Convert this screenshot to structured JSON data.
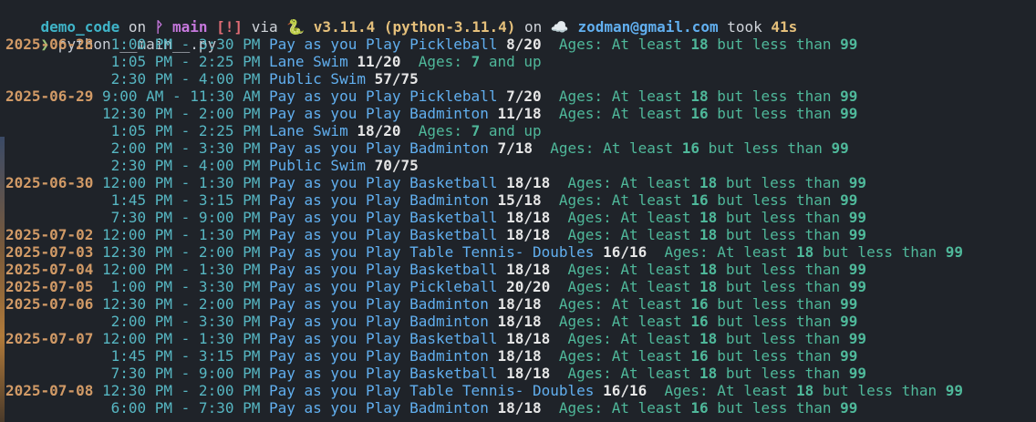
{
  "prompt": {
    "dir": "demo_code",
    "on1": " on ",
    "branch_icon": "ᚹ ",
    "branch": "main",
    "flag": " [!]",
    "via": " via ",
    "py_icon": "🐍 ",
    "py_version": "v3.11.4 (python-3.11.4)",
    "on2": " on ",
    "cloud_icon": "☁️ ",
    "user": "zodman@gmail.com",
    "took": " took ",
    "duration": "41s"
  },
  "command": {
    "chevron": "❯",
    "text": " python __main__.py"
  },
  "ages_prefix": "Ages:",
  "rows": [
    {
      "date": "2025-06-28",
      "time": " 1:00 PM - 3:30 PM",
      "activity": "Pay as you Play Pickleball",
      "count": "8/20",
      "age_kind": "range",
      "min": "18",
      "max": "99"
    },
    {
      "date": "",
      "time": " 1:05 PM - 2:25 PM",
      "activity": "Lane Swim",
      "count": "11/20",
      "age_kind": "up",
      "min": "7"
    },
    {
      "date": "",
      "time": " 2:30 PM - 4:00 PM",
      "activity": "Public Swim",
      "count": "57/75",
      "age_kind": "none"
    },
    {
      "date": "2025-06-29",
      "time": "9:00 AM - 11:30 AM",
      "activity": "Pay as you Play Pickleball",
      "count": "7/20",
      "age_kind": "range",
      "min": "18",
      "max": "99"
    },
    {
      "date": "",
      "time": "12:30 PM - 2:00 PM",
      "activity": "Pay as you Play Badminton",
      "count": "11/18",
      "age_kind": "range",
      "min": "16",
      "max": "99"
    },
    {
      "date": "",
      "time": " 1:05 PM - 2:25 PM",
      "activity": "Lane Swim",
      "count": "18/20",
      "age_kind": "up",
      "min": "7"
    },
    {
      "date": "",
      "time": " 2:00 PM - 3:30 PM",
      "activity": "Pay as you Play Badminton",
      "count": "7/18",
      "age_kind": "range",
      "min": "16",
      "max": "99"
    },
    {
      "date": "",
      "time": " 2:30 PM - 4:00 PM",
      "activity": "Public Swim",
      "count": "70/75",
      "age_kind": "none"
    },
    {
      "date": "2025-06-30",
      "time": "12:00 PM - 1:30 PM",
      "activity": "Pay as you Play Basketball",
      "count": "18/18",
      "age_kind": "range",
      "min": "18",
      "max": "99"
    },
    {
      "date": "",
      "time": " 1:45 PM - 3:15 PM",
      "activity": "Pay as you Play Badminton",
      "count": "15/18",
      "age_kind": "range",
      "min": "16",
      "max": "99"
    },
    {
      "date": "",
      "time": " 7:30 PM - 9:00 PM",
      "activity": "Pay as you Play Basketball",
      "count": "18/18",
      "age_kind": "range",
      "min": "18",
      "max": "99"
    },
    {
      "date": "2025-07-02",
      "time": "12:00 PM - 1:30 PM",
      "activity": "Pay as you Play Basketball",
      "count": "18/18",
      "age_kind": "range",
      "min": "18",
      "max": "99"
    },
    {
      "date": "2025-07-03",
      "time": "12:30 PM - 2:00 PM",
      "activity": "Pay as you Play Table Tennis- Doubles",
      "count": "16/16",
      "age_kind": "range",
      "min": "18",
      "max": "99"
    },
    {
      "date": "2025-07-04",
      "time": "12:00 PM - 1:30 PM",
      "activity": "Pay as you Play Basketball",
      "count": "18/18",
      "age_kind": "range",
      "min": "18",
      "max": "99"
    },
    {
      "date": "2025-07-05",
      "time": " 1:00 PM - 3:30 PM",
      "activity": "Pay as you Play Pickleball",
      "count": "20/20",
      "age_kind": "range",
      "min": "18",
      "max": "99"
    },
    {
      "date": "2025-07-06",
      "time": "12:30 PM - 2:00 PM",
      "activity": "Pay as you Play Badminton",
      "count": "18/18",
      "age_kind": "range",
      "min": "16",
      "max": "99"
    },
    {
      "date": "",
      "time": " 2:00 PM - 3:30 PM",
      "activity": "Pay as you Play Badminton",
      "count": "18/18",
      "age_kind": "range",
      "min": "16",
      "max": "99"
    },
    {
      "date": "2025-07-07",
      "time": "12:00 PM - 1:30 PM",
      "activity": "Pay as you Play Basketball",
      "count": "18/18",
      "age_kind": "range",
      "min": "18",
      "max": "99"
    },
    {
      "date": "",
      "time": " 1:45 PM - 3:15 PM",
      "activity": "Pay as you Play Badminton",
      "count": "18/18",
      "age_kind": "range",
      "min": "16",
      "max": "99"
    },
    {
      "date": "",
      "time": " 7:30 PM - 9:00 PM",
      "activity": "Pay as you Play Basketball",
      "count": "18/18",
      "age_kind": "range",
      "min": "18",
      "max": "99"
    },
    {
      "date": "2025-07-08",
      "time": "12:30 PM - 2:00 PM",
      "activity": "Pay as you Play Table Tennis- Doubles",
      "count": "16/16",
      "age_kind": "range",
      "min": "18",
      "max": "99"
    },
    {
      "date": "",
      "time": " 6:00 PM - 7:30 PM",
      "activity": "Pay as you Play Badminton",
      "count": "18/18",
      "age_kind": "range",
      "min": "16",
      "max": "99"
    }
  ],
  "age_words": {
    "at_least": "At least",
    "but_less_than": "but less than",
    "and_up": "and up"
  },
  "icons": {
    "branch": "git-branch-icon",
    "python": "python-snake-icon",
    "cloud": "cloud-icon",
    "chevron": "prompt-chevron-icon"
  }
}
